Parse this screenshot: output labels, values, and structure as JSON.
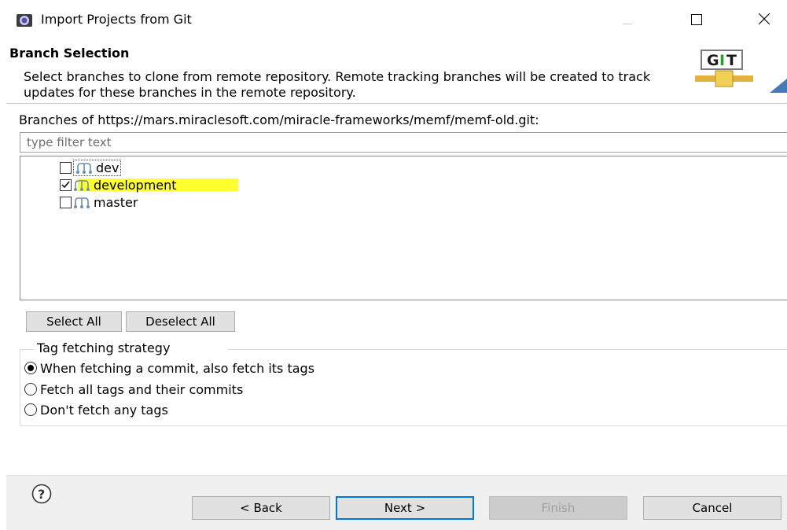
{
  "window": {
    "title": "Import Projects from Git",
    "icons": {
      "app": "eclipse-icon",
      "minimize": "minimize-icon",
      "maximize": "maximize-icon",
      "close": "close-icon"
    }
  },
  "header": {
    "title": "Branch Selection",
    "description": "Select branches to clone from remote repository. Remote tracking branches will be created to track updates for these branches in the remote repository.",
    "logo_text": "GIT"
  },
  "branches": {
    "label": "Branches of https://mars.miraclesoft.com/miracle-frameworks/memf/memf-old.git:",
    "filter_placeholder": "type filter text",
    "items": [
      {
        "name": "dev",
        "checked": false,
        "icon": "branch-icon"
      },
      {
        "name": "development",
        "checked": true,
        "icon": "branch-icon",
        "highlight": "#ffff2e"
      },
      {
        "name": "master",
        "checked": false,
        "icon": "branch-icon"
      }
    ],
    "select_all": "Select All",
    "deselect_all": "Deselect All"
  },
  "tags": {
    "legend": "Tag fetching strategy",
    "options": [
      {
        "label": "When fetching a commit, also fetch its tags",
        "selected": true
      },
      {
        "label": "Fetch all tags and their commits",
        "selected": false
      },
      {
        "label": "Don't fetch any tags",
        "selected": false
      }
    ]
  },
  "footer": {
    "help_icon": "help-icon",
    "back": "< Back",
    "next": "Next >",
    "finish": "Finish",
    "cancel": "Cancel"
  },
  "colors": {
    "accent": "#0078d7",
    "highlight": "#ffff2e",
    "button": "#e1e1e1"
  }
}
